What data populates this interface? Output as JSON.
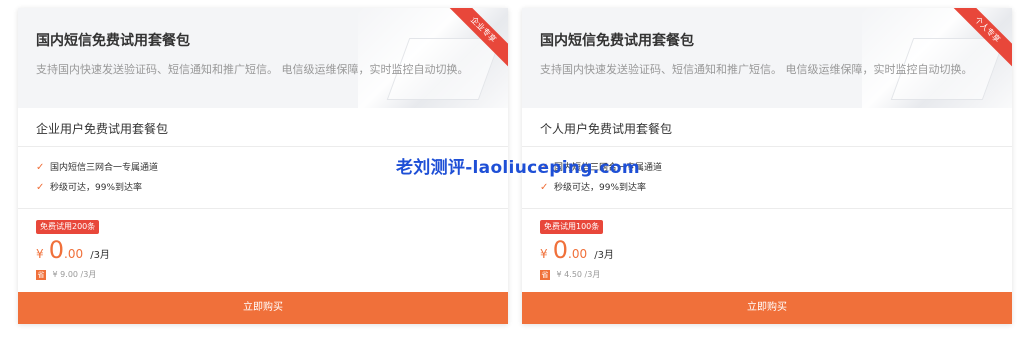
{
  "cards": [
    {
      "title": "国内短信免费试用套餐包",
      "description": "支持国内快速发送验证码、短信通知和推广短信。 电信级运维保障，实时监控自动切换。",
      "ribbon": "企业专享",
      "plan_name": "企业用户免费试用套餐包",
      "features": [
        "国内短信三网合一专属通道",
        "秒级可达，99%到达率"
      ],
      "badge": "免费试用200条",
      "price_currency": "¥",
      "price_integer": "0",
      "price_decimal": ".00",
      "price_period": "/3月",
      "original_icon": "省",
      "original_price": "¥ 9.00 /3月",
      "buy_label": "立即购买"
    },
    {
      "title": "国内短信免费试用套餐包",
      "description": "支持国内快速发送验证码、短信通知和推广短信。 电信级运维保障，实时监控自动切换。",
      "ribbon": "个人专享",
      "plan_name": "个人用户免费试用套餐包",
      "features": [
        "国内短信三网合一专属通道",
        "秒级可达，99%到达率"
      ],
      "badge": "免费试用100条",
      "price_currency": "¥",
      "price_integer": "0",
      "price_decimal": ".00",
      "price_period": "/3月",
      "original_icon": "省",
      "original_price": "¥ 4.50 /3月",
      "buy_label": "立即购买"
    }
  ],
  "watermark": "老刘测评-laoliuceping.com",
  "colors": {
    "accent": "#f0703a",
    "badge": "#e8473a",
    "watermark": "#1e4fd6"
  },
  "icons": {
    "feature_check": "check-icon"
  }
}
